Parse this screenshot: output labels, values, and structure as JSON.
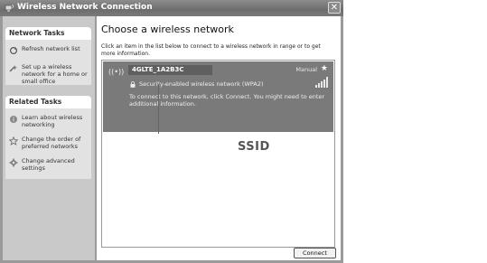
{
  "window": {
    "title": "Wireless Network Connection",
    "close_label": "✕"
  },
  "sidepane": {
    "network_tasks": {
      "heading": "Network Tasks",
      "items": [
        {
          "label": "Refresh network list",
          "icon": "refresh-icon"
        },
        {
          "label": "Set up a wireless network for a home or small office",
          "icon": "setup-wizard-icon"
        }
      ]
    },
    "related_tasks": {
      "heading": "Related Tasks",
      "items": [
        {
          "label": "Learn about wireless networking",
          "icon": "help-icon"
        },
        {
          "label": "Change the order of preferred networks",
          "icon": "star-outline-icon"
        },
        {
          "label": "Change advanced settings",
          "icon": "settings-icon"
        }
      ]
    }
  },
  "main": {
    "title": "Choose a wireless network",
    "instructions": "Click an item in the list below to connect to a wireless network in range or to get more information.",
    "networks": [
      {
        "ssid": "4GLTE_1A2B3C",
        "mode": "Manual",
        "security": "Security-enabled wireless network (WPA2)",
        "description": "To connect to this network, click Connect. You might need to enter additional information.",
        "antenna_glyph": "((•))"
      }
    ],
    "callout": "SSID",
    "connect_label": "Connect"
  },
  "colors": {
    "titlebar": "#7a7a7a",
    "sidepane": "#c9c9c9",
    "selected_item": "#7a7a7a"
  }
}
